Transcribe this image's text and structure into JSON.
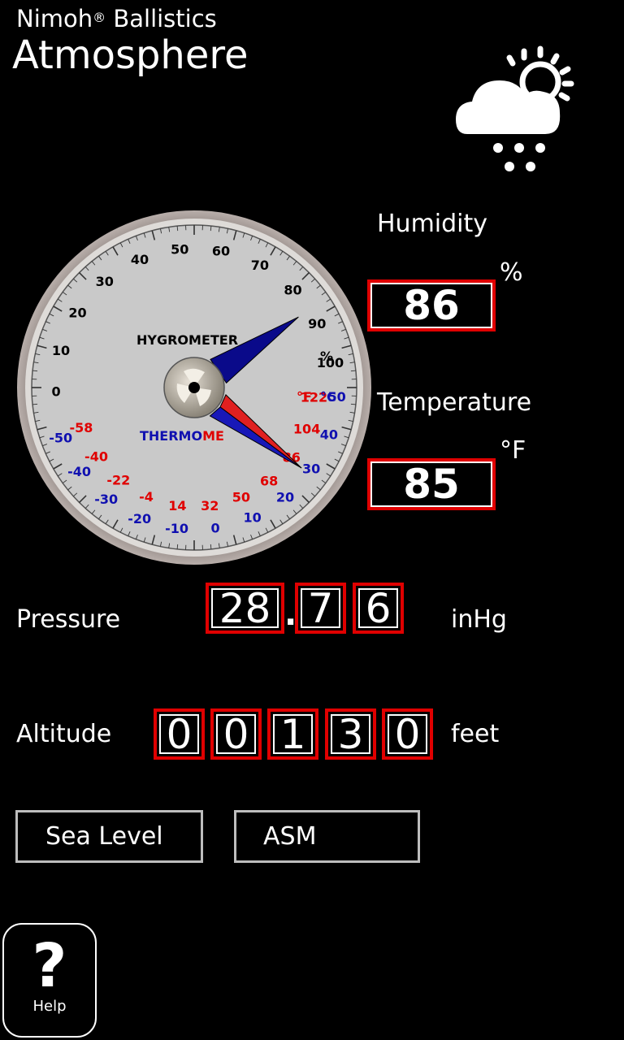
{
  "header": {
    "app_name": "Nimoh",
    "app_name_mark": "®",
    "app_name_suffix": " Ballistics",
    "title": "Atmosphere"
  },
  "weather": {
    "icon": "partly-cloudy-snow-icon"
  },
  "gauge": {
    "hygrometer_label": "HYGROMETER",
    "thermometer_label": "THERMOMETER",
    "humidity_ticks": [
      "0",
      "10",
      "20",
      "30",
      "40",
      "50",
      "60",
      "70",
      "80",
      "90",
      "100"
    ],
    "humidity_unit": "%",
    "fahrenheit_ticks": [
      "-58",
      "-40",
      "-22",
      "-4",
      "14",
      "32",
      "50",
      "68",
      "86",
      "104",
      "122"
    ],
    "celsius_ticks": [
      "-50",
      "-40",
      "-30",
      "-20",
      "-10",
      "0",
      "10",
      "20",
      "30",
      "40",
      "50"
    ],
    "fahrenheit_symbol": "°F",
    "celsius_symbol": "°C",
    "humidity_needle_value": 86,
    "temperature_needle_value_f": 85,
    "colors": {
      "humidity_needle": "#0a0a8a",
      "temp_needle": "#e02020",
      "fahrenheit": "#e00000",
      "celsius": "#1010b0"
    }
  },
  "humidity": {
    "label": "Humidity",
    "value": "86",
    "unit": "%"
  },
  "temperature": {
    "label": "Temperature",
    "value": "85",
    "unit": "°F"
  },
  "pressure": {
    "label": "Pressure",
    "digits": [
      "28",
      "7",
      "6"
    ],
    "separator": ".",
    "unit": "inHg"
  },
  "altitude": {
    "label": "Altitude",
    "digits": [
      "0",
      "0",
      "1",
      "3",
      "0"
    ],
    "unit": "feet"
  },
  "buttons": {
    "sea_level": "Sea Level",
    "asm": "ASM"
  },
  "help": {
    "glyph": "?",
    "label": "Help"
  }
}
